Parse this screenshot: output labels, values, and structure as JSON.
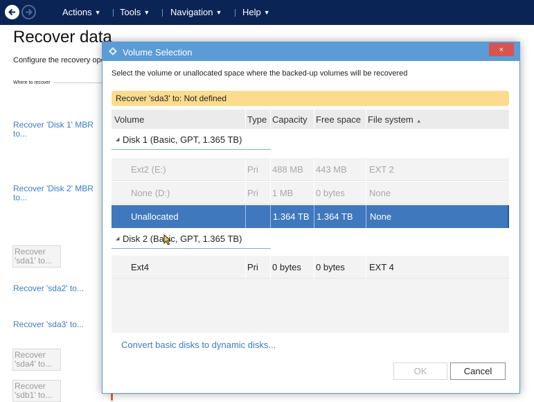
{
  "topbar": {
    "menus": [
      {
        "label": "Actions"
      },
      {
        "label": "Tools"
      },
      {
        "label": "Navigation"
      },
      {
        "label": "Help"
      }
    ]
  },
  "page": {
    "title": "Recover data",
    "description": "Configure the recovery ope",
    "section_label": "Where to recover",
    "items": [
      {
        "label": "Recover 'Disk 1' MBR to..."
      },
      {
        "label": "Recover 'Disk 2' MBR to..."
      },
      {
        "label": "Recover 'sda1' to..."
      },
      {
        "label": "Recover 'sda2' to..."
      },
      {
        "label": "Recover 'sda3' to..."
      },
      {
        "label": "Recover 'sda4' to..."
      },
      {
        "label": "Recover 'sdb1' to..."
      }
    ]
  },
  "dialog": {
    "title": "Volume Selection",
    "close_label": "×",
    "instruction": "Select the volume or unallocated space where the backed-up volumes will be recovered",
    "banner": "Recover 'sda3' to: Not defined",
    "columns": {
      "volume": "Volume",
      "type": "Type",
      "capacity": "Capacity",
      "free_space": "Free space",
      "file_system": "File system"
    },
    "disks": [
      {
        "label": "Disk 1 (Basic, GPT, 1.365 TB)",
        "rows": [
          {
            "volume": "Ext2 (E:)",
            "type": "Pri",
            "capacity": "488 MB",
            "free": "443 MB",
            "fs": "EXT 2",
            "state": "disabled"
          },
          {
            "volume": "None (D:)",
            "type": "Pri",
            "capacity": "1 MB",
            "free": "0 bytes",
            "fs": "None",
            "state": "disabled"
          },
          {
            "volume": "Unallocated",
            "type": "",
            "capacity": "1.364 TB",
            "free": "1.364 TB",
            "fs": "None",
            "state": "selected"
          }
        ]
      },
      {
        "label": "Disk 2 (Basic, GPT, 1.365 TB)",
        "rows": [
          {
            "volume": "Ext4",
            "type": "Pri",
            "capacity": "0 bytes",
            "free": "0 bytes",
            "fs": "EXT 4",
            "state": "normal"
          }
        ]
      }
    ],
    "convert_link": "Convert basic disks to dynamic disks...",
    "ok_label": "OK",
    "cancel_label": "Cancel"
  },
  "colors": {
    "topbar": "#0b2456",
    "dialog_titlebar": "#5b9bd6",
    "banner": "#fbdc8e",
    "selected_row": "#3f78bd",
    "link": "#3a7cc5",
    "close_button": "#d9534f"
  }
}
